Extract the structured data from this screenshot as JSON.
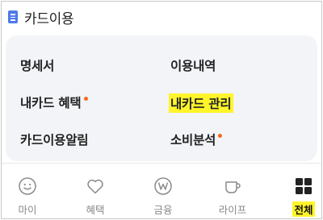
{
  "header": {
    "title": "카드이용",
    "icon": "document-icon"
  },
  "menu": {
    "items": [
      {
        "label": "명세서",
        "has_dot": false,
        "highlighted": false
      },
      {
        "label": "이용내역",
        "has_dot": false,
        "highlighted": false
      },
      {
        "label": "내카드 혜택",
        "has_dot": true,
        "highlighted": false
      },
      {
        "label": "내카드 관리",
        "has_dot": false,
        "highlighted": true
      },
      {
        "label": "카드이용알림",
        "has_dot": false,
        "highlighted": false
      },
      {
        "label": "소비분석",
        "has_dot": true,
        "highlighted": false
      }
    ]
  },
  "nav": {
    "items": [
      {
        "label": "마이",
        "icon": "smiley-icon",
        "active": false
      },
      {
        "label": "혜택",
        "icon": "heart-icon",
        "active": false
      },
      {
        "label": "금융",
        "icon": "won-coin-icon",
        "active": false
      },
      {
        "label": "라이프",
        "icon": "cup-icon",
        "active": false
      },
      {
        "label": "전체",
        "icon": "grid-icon",
        "active": true
      }
    ]
  },
  "colors": {
    "accent_highlight": "#fff52a",
    "dot": "#f26a1b",
    "doc_icon": "#4a7be8",
    "panel_bg": "#f2f4f8",
    "inactive_nav": "#888888"
  }
}
